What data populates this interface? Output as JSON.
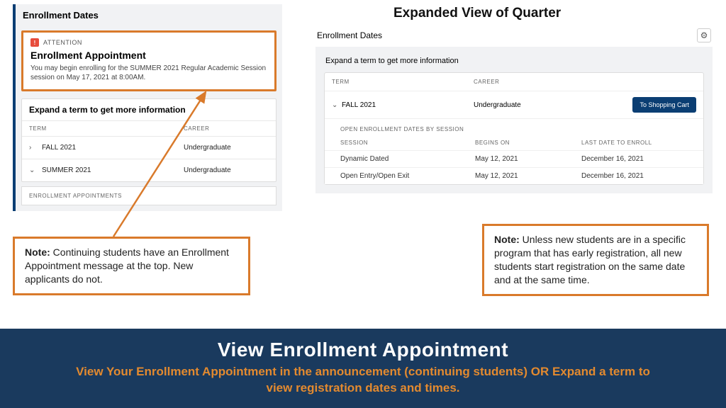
{
  "left": {
    "title": "Enrollment Dates",
    "attention": {
      "badge": "ATTENTION",
      "heading": "Enrollment Appointment",
      "body": "You may begin enrolling for the SUMMER 2021 Regular Academic Session session on May 17, 2021 at 8:00AM."
    },
    "expand_label": "Expand a term to get more information",
    "cols": {
      "term": "TERM",
      "career": "CAREER"
    },
    "rows": [
      {
        "chev": "›",
        "term": "FALL 2021",
        "career": "Undergraduate"
      },
      {
        "chev": "⌄",
        "term": "SUMMER 2021",
        "career": "Undergraduate"
      }
    ],
    "appointments_label": "ENROLLMENT APPOINTMENTS"
  },
  "right": {
    "page_heading": "Expanded View of Quarter",
    "title": "Enrollment Dates",
    "expand_label": "Expand a term to get more information",
    "cols": {
      "term": "TERM",
      "career": "CAREER"
    },
    "termrow": {
      "chev": "⌄",
      "term": "FALL 2021",
      "career": "Undergraduate",
      "button": "To Shopping Cart"
    },
    "subhead": "OPEN ENROLLMENT DATES BY SESSION",
    "sesscols": {
      "session": "SESSION",
      "begins": "BEGINS ON",
      "last": "LAST DATE TO ENROLL"
    },
    "sessions": [
      {
        "session": "Dynamic Dated",
        "begins": "May 12, 2021",
        "last": "December 16, 2021"
      },
      {
        "session": "Open Entry/Open Exit",
        "begins": "May 12, 2021",
        "last": "December 16, 2021"
      }
    ]
  },
  "notes": {
    "left": {
      "bold": "Note:",
      "text": " Continuing students have an Enrollment Appointment message at the top. New applicants do not."
    },
    "right": {
      "bold": "Note:",
      "text": " Unless new students are in a specific program that has early registration, all new students start registration on the same date and at the same time."
    }
  },
  "banner": {
    "heading": "View Enrollment Appointment",
    "sub": "View Your Enrollment Appointment in the announcement (continuing students) OR Expand a term to view registration dates and times."
  }
}
